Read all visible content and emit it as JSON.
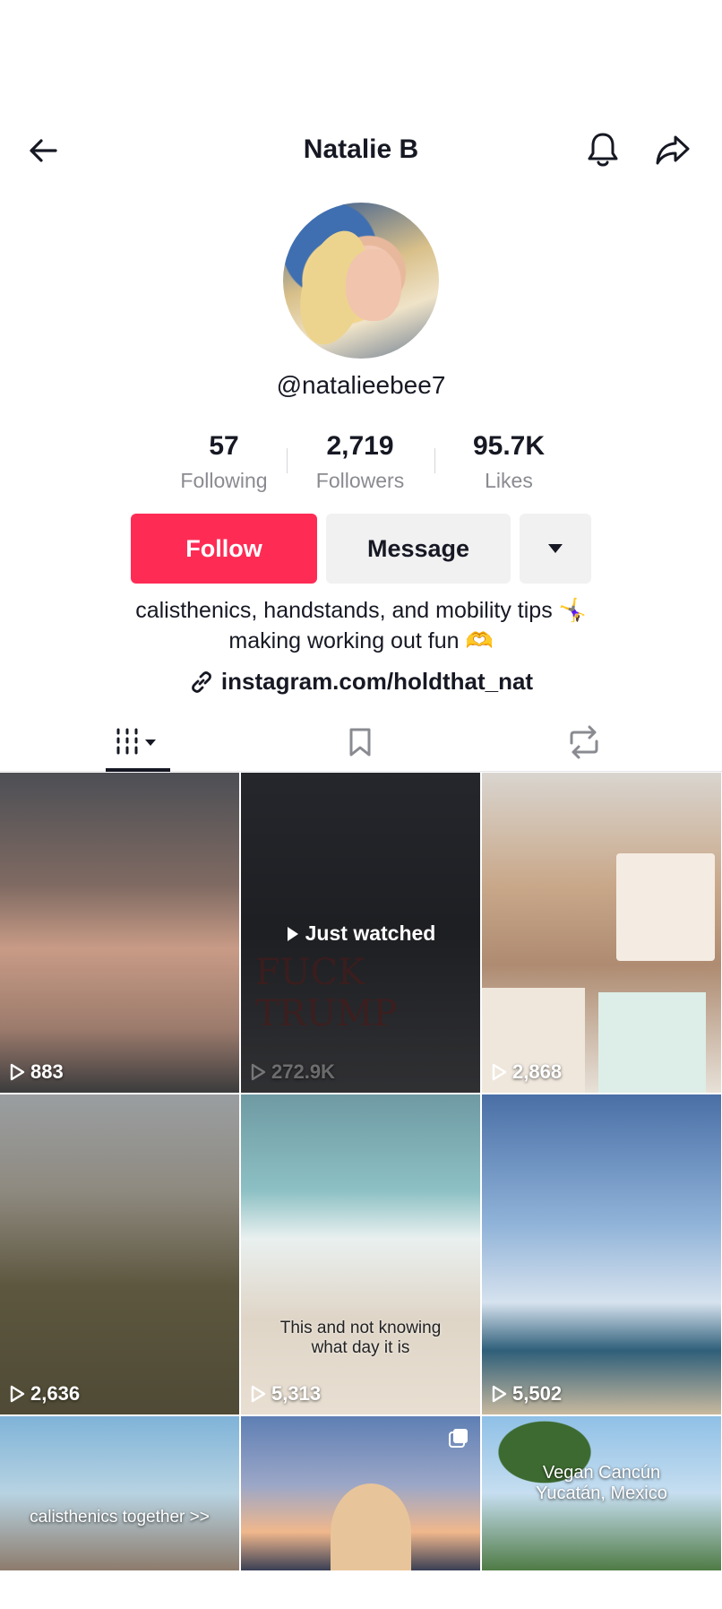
{
  "header": {
    "title": "Natalie B"
  },
  "profile": {
    "username": "@natalieebee7",
    "stats": [
      {
        "value": "57",
        "label": "Following"
      },
      {
        "value": "2,719",
        "label": "Followers"
      },
      {
        "value": "95.7K",
        "label": "Likes"
      }
    ],
    "buttons": {
      "follow": "Follow",
      "message": "Message"
    },
    "bio_line1": "calisthenics, handstands, and mobility tips 🤸‍♀️",
    "bio_line2": "making working out fun 🫶",
    "link": "instagram.com/holdthat_nat"
  },
  "tabs": [
    {
      "icon": "videos-grid-icon",
      "selected": true
    },
    {
      "icon": "bookmark-icon",
      "selected": false
    },
    {
      "icon": "repost-icon",
      "selected": false
    }
  ],
  "videos": [
    {
      "views": "883"
    },
    {
      "views": "272.9K",
      "overlay": "Just watched",
      "graffiti": "FUCK TRUMP"
    },
    {
      "views": "2,868"
    },
    {
      "views": "2,636"
    },
    {
      "views": "5,313",
      "caption": "This and not knowing what day it is"
    },
    {
      "views": "5,502"
    },
    {
      "caption": "calisthenics together >>"
    },
    {
      "icon": "multi-photo-icon"
    },
    {
      "caption": "Vegan Cancún Yucatán, Mexico"
    }
  ],
  "colors": {
    "follow": "#fe2c55",
    "text": "#161823",
    "muted": "#8a8b91"
  }
}
